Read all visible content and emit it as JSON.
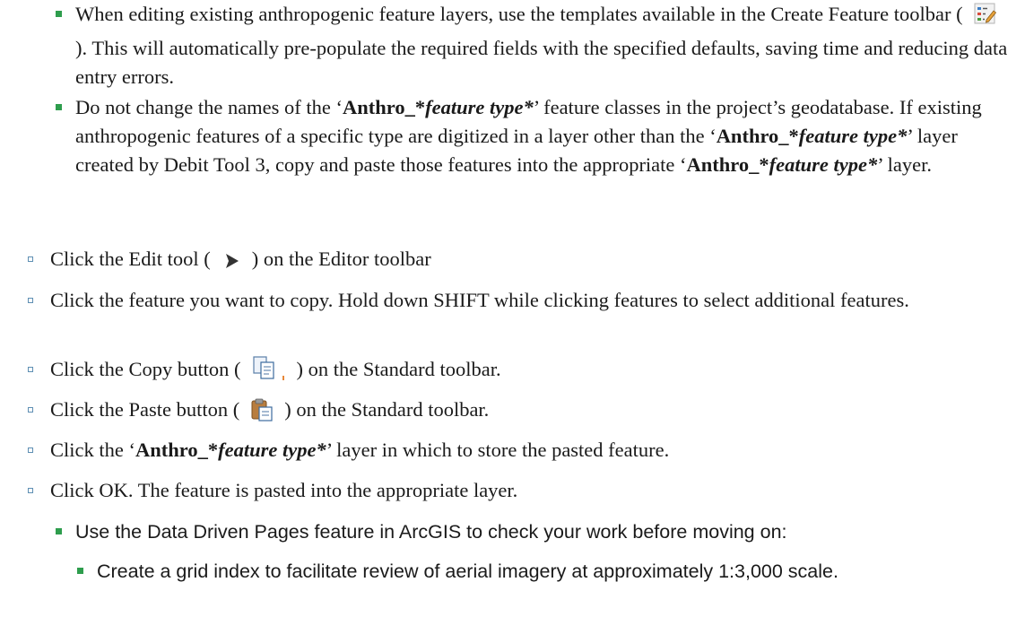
{
  "colors": {
    "square_bullet": "#2e9d4d",
    "hollow_bullet": "#5e8fb3",
    "text": "#1a1a1a"
  },
  "items": [
    {
      "bullet": "square",
      "segments": [
        "When editing existing anthropogenic feature layers, use the templates available in the Create Feature toolbar (",
        "). This will automatically pre-populate the required fields with the specified defaults, saving time and reducing data entry errors."
      ],
      "icon": "create-features-template-icon"
    },
    {
      "bullet": "square",
      "segments": [
        "Do not change the names of the ‘",
        "Anthro_*",
        "feature type*",
        "’ feature classes in the project’s geodatabase. If existing anthropogenic features of a specific type are digitized in a layer other than the ‘",
        "Anthro_*",
        "feature type*",
        "’ layer created by Debit Tool 3, copy and paste those features into the appropriate ‘",
        "Anthro_*",
        "feature type*",
        "’ layer."
      ]
    },
    {
      "bullet": "hollow",
      "segments": [
        "Click the Edit tool (",
        ") on the Editor toolbar"
      ],
      "icon": "edit-tool-arrow-icon"
    },
    {
      "bullet": "hollow",
      "segments": [
        "Click the feature you want to copy. Hold down SHIFT while clicking features to select additional features."
      ]
    },
    {
      "bullet": "hollow",
      "segments": [
        "Click the Copy button (",
        ") on the Standard toolbar."
      ],
      "icon": "copy-icon"
    },
    {
      "bullet": "hollow",
      "segments": [
        "Click the Paste button (",
        ") on the Standard toolbar."
      ],
      "icon": "paste-icon"
    },
    {
      "bullet": "hollow",
      "segments": [
        "Click the ‘",
        "Anthro_*",
        "feature type*",
        "’ layer in which to store the pasted feature."
      ]
    },
    {
      "bullet": "hollow",
      "segments": [
        "Click OK. The feature is pasted into the appropriate layer."
      ]
    },
    {
      "bullet": "square",
      "segments": [
        "Use the Data Driven Pages feature in ArcGIS to check your work before moving on:"
      ]
    },
    {
      "bullet": "square",
      "segments": [
        "Create a grid index to facilitate review of aerial imagery at approximately 1:3,000 scale."
      ]
    }
  ]
}
